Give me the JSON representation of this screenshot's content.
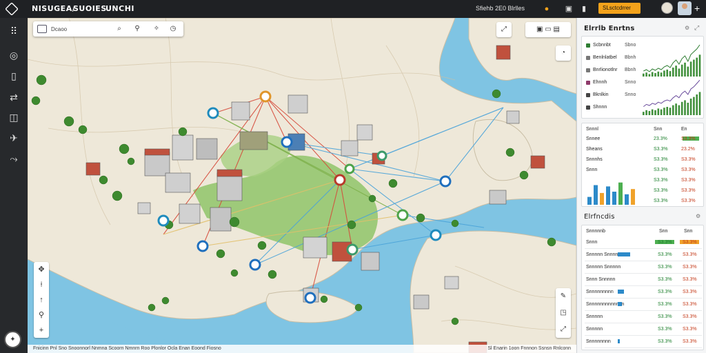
{
  "topbar": {
    "nav": [
      "NISUGEA/",
      "SUOIES",
      "UNCHI"
    ],
    "status_text": "Sfiehb 2E0 Blrlles",
    "alert_label": "SLsctcdrrer",
    "icons": [
      "bell-icon",
      "settings-icon",
      "menu-icon"
    ]
  },
  "sidebar": {
    "icons": [
      "dashboard-icon",
      "document-icon",
      "route-icon",
      "layers-icon",
      "share-icon",
      "chart-icon"
    ]
  },
  "map": {
    "search_value": "Dcaoo",
    "search_icons": [
      "search-icon",
      "filter-icon",
      "tools-icon",
      "clock-icon"
    ],
    "status_left": "Fnicinn  Pnl  Sno  Snoonnorl  Nnmna  Scoorn  Nmnrn  Roo Plonlor  Ocla Enan Eoond Fiosno",
    "status_right": "Sl Enarin  1oon  Fnnnon  Ssnsn  Rnlconn"
  },
  "panel": {
    "title": "Elrrlb Enrtns",
    "subtitle": "Elrfncdis",
    "card1": {
      "rows": [
        {
          "label": "Scbnnbt",
          "val": "Sbno",
          "color": "#2e7d32"
        },
        {
          "label": "Benlnlatbel",
          "val": "Bbnh",
          "color": "#777777"
        },
        {
          "label": "Bnrlionotlnr",
          "val": "Bbnh",
          "color": "#777777"
        },
        {
          "label": "Ehnnh",
          "val": "Snno",
          "color": "#8e3a6a"
        },
        {
          "label": "Bknlkin",
          "val": "Snno",
          "color": "#444444"
        },
        {
          "label": "Shnnn",
          "val": "",
          "color": "#444444"
        }
      ]
    },
    "card2": {
      "headers": [
        "Snnnl",
        "Snn",
        "En"
      ],
      "rows": [
        {
          "label": "Snnee",
          "v1": "23.3%",
          "v2": "S3.3%"
        },
        {
          "label": "Sheans",
          "v1": "S3.3%",
          "v2": "23.2%"
        },
        {
          "label": "Snnnhs",
          "v1": "S3.3%",
          "v2": "S3.3%"
        },
        {
          "label": "Snnn",
          "v1": "S3.3%",
          "v2": "S3.3%"
        },
        {
          "label": "",
          "v1": "S3.3%",
          "v2": "S3.3%"
        },
        {
          "label": "",
          "v1": "S3.3%",
          "v2": "S3.3%"
        },
        {
          "label": "",
          "v1": "S3.3%",
          "v2": "S3.3%"
        }
      ],
      "bars": [
        0.3,
        0.75,
        0.45,
        0.7,
        0.5,
        0.85,
        0.4,
        0.6
      ]
    },
    "card3": {
      "headers": [
        "Snnnnnb",
        "Snn",
        "Snn"
      ],
      "rows": [
        {
          "label": "Snnn",
          "v1": "S3.3%",
          "v2": "S3.3%",
          "bar": 0
        },
        {
          "label": "Snnnnn Snnnn",
          "v1": "S3.3%",
          "v2": "S3.3%",
          "bar": 0.6
        },
        {
          "label": "Snnnnn Snnnnn",
          "v1": "S3.3%",
          "v2": "S3.3%",
          "bar": 0
        },
        {
          "label": "Snnn Snnnnn",
          "v1": "S3.3%",
          "v2": "S3.3%",
          "bar": 0
        },
        {
          "label": "Snnnnnnnnn",
          "v1": "S3.3%",
          "v2": "S3.3%",
          "bar": 0.3
        },
        {
          "label": "Snnnnnnnnnnnnn",
          "v1": "S3.3%",
          "v2": "S3.3%",
          "bar": 0.2
        },
        {
          "label": "Snnnnn",
          "v1": "S3.3%",
          "v2": "S3.3%",
          "bar": 0
        },
        {
          "label": "Snnnnn",
          "v1": "S3.3%",
          "v2": "S3.3%",
          "bar": 0
        },
        {
          "label": "Snnnnnnnn",
          "v1": "S3.3%",
          "v2": "S3.3%",
          "bar": 0.1
        }
      ]
    }
  }
}
